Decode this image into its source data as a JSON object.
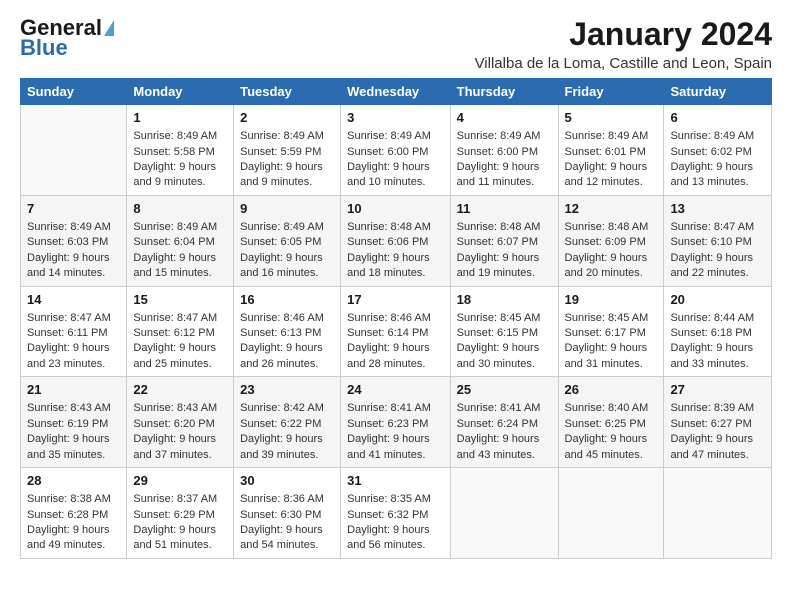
{
  "logo": {
    "text1": "General",
    "text2": "Blue"
  },
  "header": {
    "month": "January 2024",
    "location": "Villalba de la Loma, Castille and Leon, Spain"
  },
  "days_of_week": [
    "Sunday",
    "Monday",
    "Tuesday",
    "Wednesday",
    "Thursday",
    "Friday",
    "Saturday"
  ],
  "weeks": [
    [
      {
        "day": "",
        "data": ""
      },
      {
        "day": "1",
        "data": "Sunrise: 8:49 AM\nSunset: 5:58 PM\nDaylight: 9 hours\nand 9 minutes."
      },
      {
        "day": "2",
        "data": "Sunrise: 8:49 AM\nSunset: 5:59 PM\nDaylight: 9 hours\nand 9 minutes."
      },
      {
        "day": "3",
        "data": "Sunrise: 8:49 AM\nSunset: 6:00 PM\nDaylight: 9 hours\nand 10 minutes."
      },
      {
        "day": "4",
        "data": "Sunrise: 8:49 AM\nSunset: 6:00 PM\nDaylight: 9 hours\nand 11 minutes."
      },
      {
        "day": "5",
        "data": "Sunrise: 8:49 AM\nSunset: 6:01 PM\nDaylight: 9 hours\nand 12 minutes."
      },
      {
        "day": "6",
        "data": "Sunrise: 8:49 AM\nSunset: 6:02 PM\nDaylight: 9 hours\nand 13 minutes."
      }
    ],
    [
      {
        "day": "7",
        "data": "Sunrise: 8:49 AM\nSunset: 6:03 PM\nDaylight: 9 hours\nand 14 minutes."
      },
      {
        "day": "8",
        "data": "Sunrise: 8:49 AM\nSunset: 6:04 PM\nDaylight: 9 hours\nand 15 minutes."
      },
      {
        "day": "9",
        "data": "Sunrise: 8:49 AM\nSunset: 6:05 PM\nDaylight: 9 hours\nand 16 minutes."
      },
      {
        "day": "10",
        "data": "Sunrise: 8:48 AM\nSunset: 6:06 PM\nDaylight: 9 hours\nand 18 minutes."
      },
      {
        "day": "11",
        "data": "Sunrise: 8:48 AM\nSunset: 6:07 PM\nDaylight: 9 hours\nand 19 minutes."
      },
      {
        "day": "12",
        "data": "Sunrise: 8:48 AM\nSunset: 6:09 PM\nDaylight: 9 hours\nand 20 minutes."
      },
      {
        "day": "13",
        "data": "Sunrise: 8:47 AM\nSunset: 6:10 PM\nDaylight: 9 hours\nand 22 minutes."
      }
    ],
    [
      {
        "day": "14",
        "data": "Sunrise: 8:47 AM\nSunset: 6:11 PM\nDaylight: 9 hours\nand 23 minutes."
      },
      {
        "day": "15",
        "data": "Sunrise: 8:47 AM\nSunset: 6:12 PM\nDaylight: 9 hours\nand 25 minutes."
      },
      {
        "day": "16",
        "data": "Sunrise: 8:46 AM\nSunset: 6:13 PM\nDaylight: 9 hours\nand 26 minutes."
      },
      {
        "day": "17",
        "data": "Sunrise: 8:46 AM\nSunset: 6:14 PM\nDaylight: 9 hours\nand 28 minutes."
      },
      {
        "day": "18",
        "data": "Sunrise: 8:45 AM\nSunset: 6:15 PM\nDaylight: 9 hours\nand 30 minutes."
      },
      {
        "day": "19",
        "data": "Sunrise: 8:45 AM\nSunset: 6:17 PM\nDaylight: 9 hours\nand 31 minutes."
      },
      {
        "day": "20",
        "data": "Sunrise: 8:44 AM\nSunset: 6:18 PM\nDaylight: 9 hours\nand 33 minutes."
      }
    ],
    [
      {
        "day": "21",
        "data": "Sunrise: 8:43 AM\nSunset: 6:19 PM\nDaylight: 9 hours\nand 35 minutes."
      },
      {
        "day": "22",
        "data": "Sunrise: 8:43 AM\nSunset: 6:20 PM\nDaylight: 9 hours\nand 37 minutes."
      },
      {
        "day": "23",
        "data": "Sunrise: 8:42 AM\nSunset: 6:22 PM\nDaylight: 9 hours\nand 39 minutes."
      },
      {
        "day": "24",
        "data": "Sunrise: 8:41 AM\nSunset: 6:23 PM\nDaylight: 9 hours\nand 41 minutes."
      },
      {
        "day": "25",
        "data": "Sunrise: 8:41 AM\nSunset: 6:24 PM\nDaylight: 9 hours\nand 43 minutes."
      },
      {
        "day": "26",
        "data": "Sunrise: 8:40 AM\nSunset: 6:25 PM\nDaylight: 9 hours\nand 45 minutes."
      },
      {
        "day": "27",
        "data": "Sunrise: 8:39 AM\nSunset: 6:27 PM\nDaylight: 9 hours\nand 47 minutes."
      }
    ],
    [
      {
        "day": "28",
        "data": "Sunrise: 8:38 AM\nSunset: 6:28 PM\nDaylight: 9 hours\nand 49 minutes."
      },
      {
        "day": "29",
        "data": "Sunrise: 8:37 AM\nSunset: 6:29 PM\nDaylight: 9 hours\nand 51 minutes."
      },
      {
        "day": "30",
        "data": "Sunrise: 8:36 AM\nSunset: 6:30 PM\nDaylight: 9 hours\nand 54 minutes."
      },
      {
        "day": "31",
        "data": "Sunrise: 8:35 AM\nSunset: 6:32 PM\nDaylight: 9 hours\nand 56 minutes."
      },
      {
        "day": "",
        "data": ""
      },
      {
        "day": "",
        "data": ""
      },
      {
        "day": "",
        "data": ""
      }
    ]
  ]
}
